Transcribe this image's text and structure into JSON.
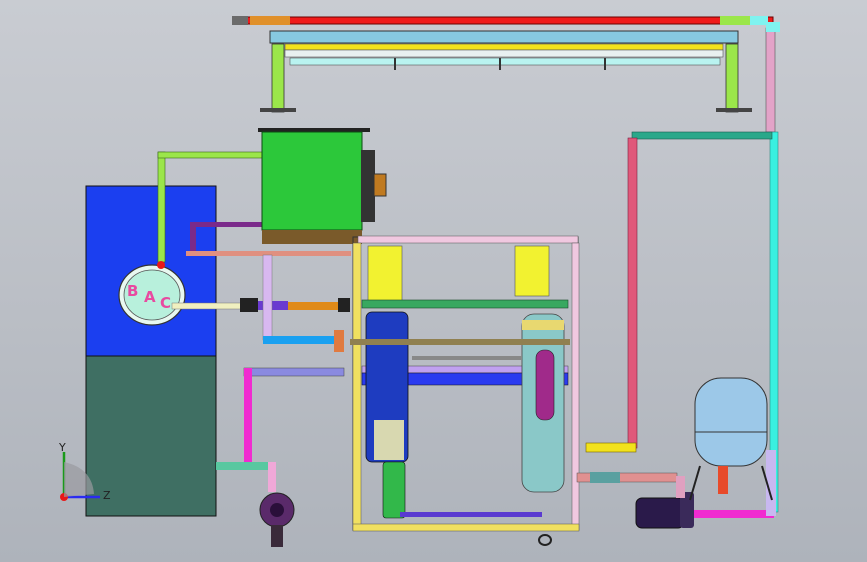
{
  "window": {
    "background_top": "#c9ccd2",
    "background_bottom": "#aeb3bb"
  },
  "tank": {
    "port_labels": [
      "B",
      "A",
      "C"
    ],
    "upper_color": "#1b3ff0",
    "lower_color": "#3f6f63"
  },
  "triad": {
    "y_label": "Y",
    "z_label": "Z"
  },
  "pipes": {
    "hot_supply": "#f01a1a",
    "cold_return": "#7ff3f0",
    "cooling_line": "#9be64a",
    "yellow_line": "#f2e21c",
    "drain_line": "#f02bd0"
  },
  "equipment_icons": [
    "cooling-tower-header-icon",
    "condenser-fan-icon",
    "pump-icon",
    "expansion-tank-icon",
    "chiller-frame-icon"
  ]
}
